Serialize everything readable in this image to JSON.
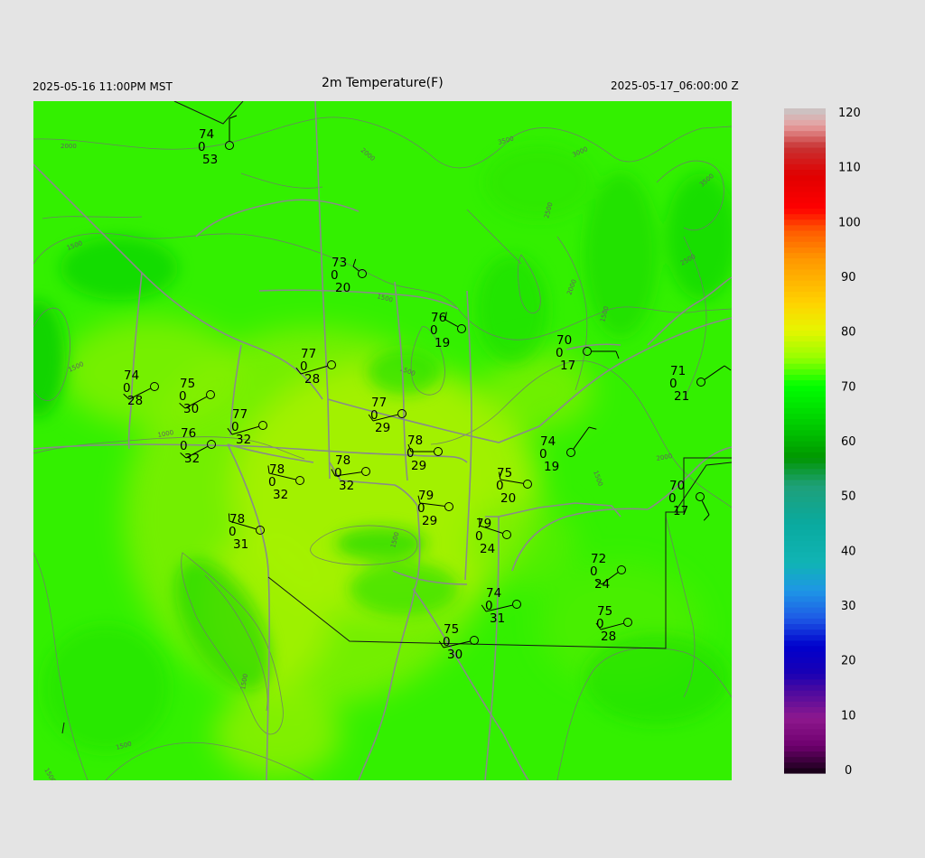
{
  "header": {
    "valid_local": "2025-05-16 11:00PM MST",
    "title": "2m Temperature(F)",
    "valid_utc": "2025-05-17_06:00:00 Z"
  },
  "colorbar": {
    "labels": [
      "120",
      "110",
      "100",
      "90",
      "80",
      "70",
      "60",
      "50",
      "40",
      "30",
      "20",
      "10",
      "0"
    ],
    "min": 0,
    "max": 120,
    "stops": [
      {
        "v": 0,
        "c": "#120012"
      },
      {
        "v": 5,
        "c": "#6e006e"
      },
      {
        "v": 10,
        "c": "#8e188e"
      },
      {
        "v": 15,
        "c": "#4a0aa0"
      },
      {
        "v": 18,
        "c": "#1a00b4"
      },
      {
        "v": 23,
        "c": "#0000cc"
      },
      {
        "v": 28,
        "c": "#1e5ae6"
      },
      {
        "v": 33,
        "c": "#1e96e6"
      },
      {
        "v": 38,
        "c": "#10b4b4"
      },
      {
        "v": 45,
        "c": "#0aaaa0"
      },
      {
        "v": 52,
        "c": "#1ea078"
      },
      {
        "v": 57,
        "c": "#009600"
      },
      {
        "v": 63,
        "c": "#00cc00"
      },
      {
        "v": 70,
        "c": "#00ff00"
      },
      {
        "v": 75,
        "c": "#96ff00"
      },
      {
        "v": 80,
        "c": "#e6f500"
      },
      {
        "v": 85,
        "c": "#ffd200"
      },
      {
        "v": 93,
        "c": "#ff9600"
      },
      {
        "v": 98,
        "c": "#ff5a00"
      },
      {
        "v": 102,
        "c": "#ff0000"
      },
      {
        "v": 108,
        "c": "#e00000"
      },
      {
        "v": 113,
        "c": "#c83232"
      },
      {
        "v": 117,
        "c": "#e6a0a0"
      },
      {
        "v": 120,
        "c": "#c8c8c8"
      }
    ]
  },
  "contour_labels": [
    "2000",
    "1500",
    "1000",
    "1500",
    "2000",
    "3500",
    "3000",
    "2500",
    "2000",
    "1500",
    "2500",
    "3500",
    "1500",
    "1500",
    "1500",
    "2000",
    "1500",
    "1500",
    "1500",
    "1500"
  ],
  "stations": [
    {
      "t": "74",
      "p": "0",
      "d": "53"
    },
    {
      "t": "73",
      "p": "0",
      "d": "20"
    },
    {
      "t": "76",
      "p": "0",
      "d": "19"
    },
    {
      "t": "70",
      "p": "0",
      "d": "17"
    },
    {
      "t": "71",
      "p": "0",
      "d": "21"
    },
    {
      "t": "77",
      "p": "0",
      "d": "28"
    },
    {
      "t": "74",
      "p": "0",
      "d": "28"
    },
    {
      "t": "75",
      "p": "0",
      "d": "30"
    },
    {
      "t": "77",
      "p": "0",
      "d": "29"
    },
    {
      "t": "77",
      "p": "0",
      "d": "32"
    },
    {
      "t": "76",
      "p": "0",
      "d": "32"
    },
    {
      "t": "78",
      "p": "0",
      "d": "29"
    },
    {
      "t": "74",
      "p": "0",
      "d": "19"
    },
    {
      "t": "78",
      "p": "0",
      "d": "32"
    },
    {
      "t": "78",
      "p": "0",
      "d": "32"
    },
    {
      "t": "75",
      "p": "0",
      "d": "20"
    },
    {
      "t": "79",
      "p": "0",
      "d": "29"
    },
    {
      "t": "70",
      "p": "0",
      "d": "17"
    },
    {
      "t": "78",
      "p": "0",
      "d": "31"
    },
    {
      "t": "79",
      "p": "0",
      "d": "24"
    },
    {
      "t": "72",
      "p": "0",
      "d": "24"
    },
    {
      "t": "74",
      "p": "0",
      "d": "31"
    },
    {
      "t": "75",
      "p": "0",
      "d": "28"
    },
    {
      "t": "75",
      "p": "0",
      "d": "30"
    }
  ]
}
